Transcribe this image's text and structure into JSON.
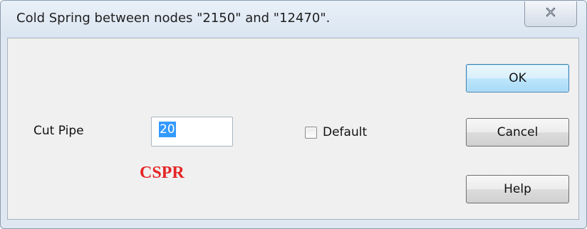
{
  "window": {
    "title": "Cold Spring between nodes \"2150\" and \"12470\".",
    "close_icon": "close-icon"
  },
  "form": {
    "cut_pipe_label": "Cut Pipe",
    "cut_pipe_value": "20",
    "default_label": "Default",
    "default_checked": false,
    "annotation": "CSPR"
  },
  "buttons": {
    "ok": "OK",
    "cancel": "Cancel",
    "help": "Help"
  },
  "colors": {
    "annotation": "#e52525",
    "selection": "#3399ff",
    "default_button_border": "#3c7fb1"
  }
}
